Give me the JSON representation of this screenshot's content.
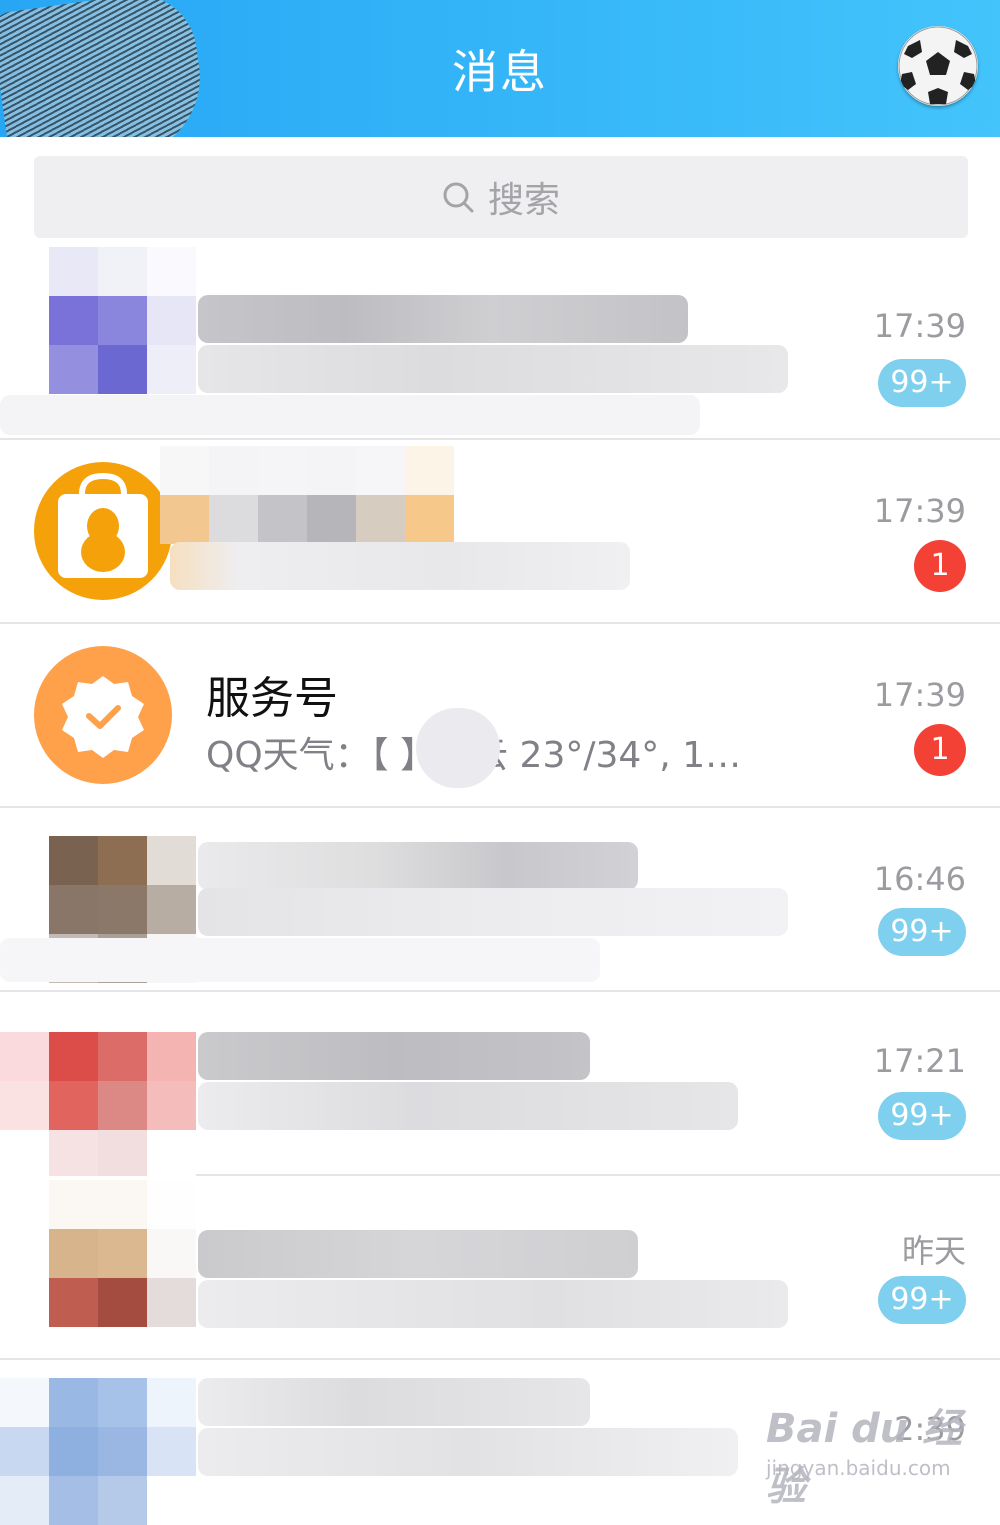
{
  "header": {
    "title": "消息"
  },
  "search": {
    "placeholder": "搜索"
  },
  "rows": [
    {
      "time": "17:39",
      "badge": "99+"
    },
    {
      "time": "17:39",
      "badge": "1"
    },
    {
      "name": "服务号",
      "preview": "QQ天气：【      】多云 23°/34°, 1…",
      "time": "17:39",
      "badge": "1"
    },
    {
      "time": "16:46",
      "badge": "99+"
    },
    {
      "time": "17:21",
      "badge": "99+"
    },
    {
      "time": "昨天",
      "badge": "99+"
    },
    {
      "time": "2:39"
    }
  ],
  "watermark": {
    "brand": "Bai du 经验",
    "url": "jingyan.baidu.com"
  },
  "colors": {
    "header": "#34b5f8",
    "badge_blue": "#7fd0ee",
    "badge_red": "#f34235",
    "service_orange": "#ffa04a",
    "shop_orange": "#f5a10a"
  }
}
